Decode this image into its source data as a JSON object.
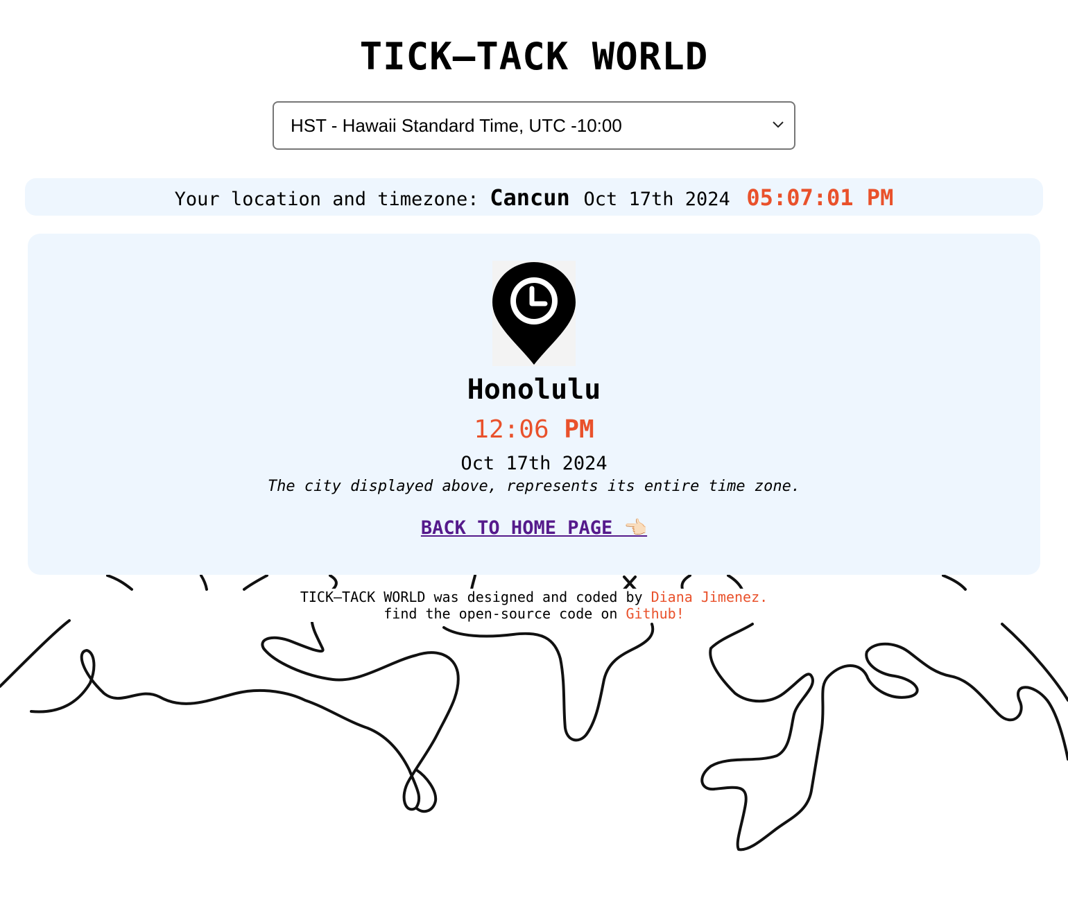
{
  "app": {
    "title": "TICK–TACK WORLD"
  },
  "timezone_select": {
    "selected": "HST - Hawaii Standard Time, UTC -10:00"
  },
  "user_location": {
    "label": "Your location and timezone:",
    "city": "Cancun",
    "date": "Oct 17th 2024",
    "time": "05:07:01 PM"
  },
  "city_card": {
    "icon": "location-clock-pin-icon",
    "city": "Honolulu",
    "time": "12:06",
    "ampm": "PM",
    "date": "Oct 17th 2024",
    "note": "The city displayed above, represents its entire time zone.",
    "back_link": "BACK TO HOME PAGE 👈🏻"
  },
  "footer": {
    "line1_prefix": "TICK–TACK WORLD was designed and coded by",
    "author": "Diana Jimenez.",
    "line2_prefix": "find the open-source code on",
    "github": "Github!"
  },
  "colors": {
    "accent": "#e9512b",
    "panel": "#eef6fe",
    "link_visited": "#551a8b"
  }
}
